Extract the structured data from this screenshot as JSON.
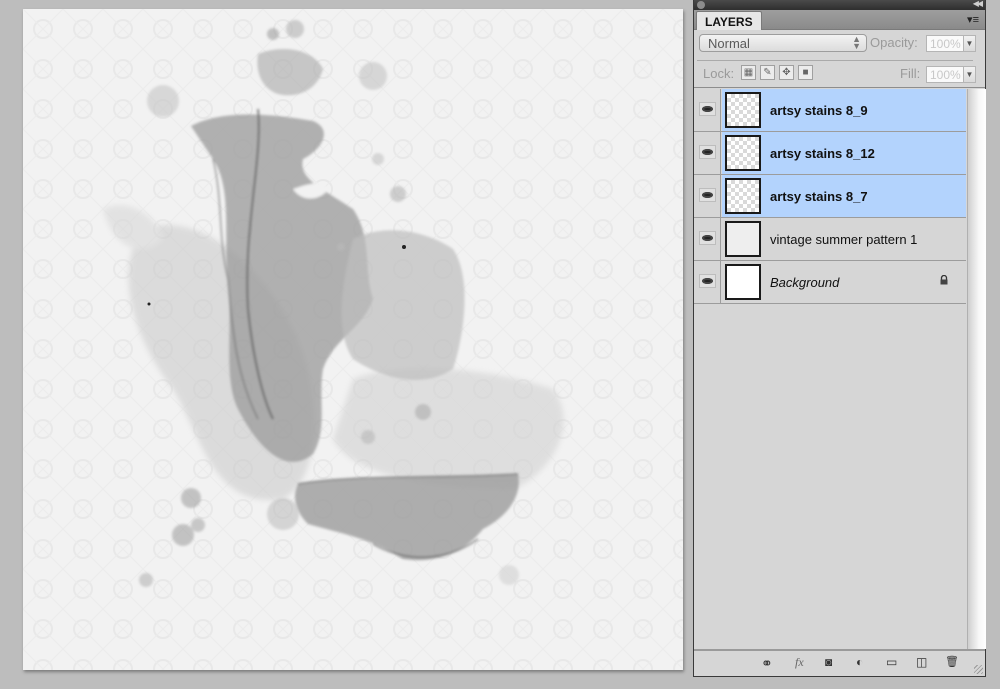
{
  "document": {
    "description": "artsy watercolor stain composite on vintage pattern paper"
  },
  "panel": {
    "tab_label": "LAYERS",
    "blend_mode": "Normal",
    "opacity_label": "Opacity:",
    "opacity_value": "100%",
    "lock_label": "Lock:",
    "fill_label": "Fill:",
    "fill_value": "100%",
    "lock_buttons": [
      "lock-transparent-pixels",
      "lock-image-pixels",
      "lock-position",
      "lock-all"
    ],
    "layers": [
      {
        "name": "artsy stains 8_9",
        "visible": true,
        "selected": true,
        "thumb": "transparent",
        "locked": false
      },
      {
        "name": "artsy stains 8_12",
        "visible": true,
        "selected": true,
        "thumb": "transparent",
        "locked": false
      },
      {
        "name": "artsy stains 8_7",
        "visible": true,
        "selected": true,
        "thumb": "transparent",
        "locked": false
      },
      {
        "name": "vintage summer pattern 1",
        "visible": true,
        "selected": false,
        "thumb": "pattern",
        "locked": false
      },
      {
        "name": "Background",
        "visible": true,
        "selected": false,
        "thumb": "white",
        "locked": true
      }
    ],
    "bottom_buttons": [
      {
        "name": "link-layers",
        "glyph": "⚭"
      },
      {
        "name": "layer-style",
        "glyph": "fx"
      },
      {
        "name": "add-mask",
        "glyph": "◙"
      },
      {
        "name": "adjustment-layer",
        "glyph": "◐"
      },
      {
        "name": "new-group",
        "glyph": "▭"
      },
      {
        "name": "new-layer",
        "glyph": "◫"
      },
      {
        "name": "delete-layer",
        "glyph": "🗑"
      }
    ]
  },
  "colors": {
    "selection": "#b3d3fd",
    "panel_bg": "#d6d6d6",
    "workspace": "#bdbdbd"
  }
}
